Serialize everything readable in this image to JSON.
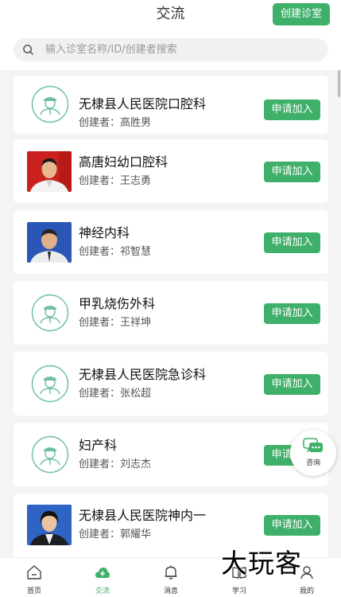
{
  "header": {
    "title": "交流",
    "create_button": "创建诊室"
  },
  "search": {
    "placeholder": "输入诊室名称/ID/创建者搜索"
  },
  "clinics": [
    {
      "name": "无棣县人民医院口腔科",
      "creator": "创建者：高胜男",
      "avatar": "logo",
      "join": "申请加入"
    },
    {
      "name": "高唐妇幼口腔科",
      "creator": "创建者：王志勇",
      "avatar": "photo-red",
      "join": "申请加入"
    },
    {
      "name": "神经内科",
      "creator": "创建者：祁智慧",
      "avatar": "photo-blue",
      "join": "申请加入"
    },
    {
      "name": "甲乳烧伤外科",
      "creator": "创建者：王祥坤",
      "avatar": "logo",
      "join": "申请加入"
    },
    {
      "name": "无棣县人民医院急诊科",
      "creator": "创建者：张松超",
      "avatar": "logo",
      "join": "申请加入"
    },
    {
      "name": "妇产科",
      "creator": "创建者：刘志杰",
      "avatar": "logo",
      "join": "申请加入"
    },
    {
      "name": "无棣县人民医院神内一",
      "creator": "创建者：郭耀华",
      "avatar": "photo-blue-female",
      "join": "申请加入"
    }
  ],
  "consult": {
    "label": "咨询",
    "icon": "chat-bubble-icon"
  },
  "tabs": [
    {
      "label": "首页",
      "icon": "home-icon"
    },
    {
      "label": "交流",
      "icon": "cloud-plus-icon",
      "active": true
    },
    {
      "label": "消息",
      "icon": "bell-icon"
    },
    {
      "label": "学习",
      "icon": "book-icon"
    },
    {
      "label": "我的",
      "icon": "user-icon"
    }
  ],
  "watermark": "大玩客",
  "colors": {
    "accent": "#3fb069",
    "logo_teal": "#6cbfa6",
    "background": "#f4f4f4"
  }
}
